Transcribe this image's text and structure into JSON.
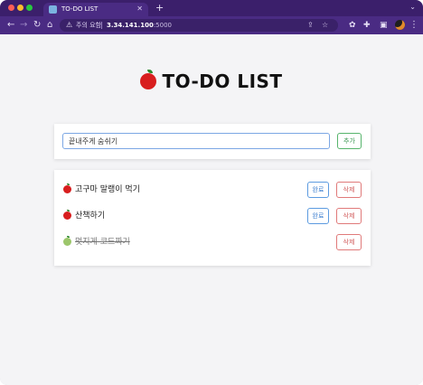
{
  "browser": {
    "tab_title": "TO-DO LIST",
    "new_tab_label": "+",
    "security_label": "주의 요함",
    "url_host": "3.34.141.100",
    "url_port": ":5000"
  },
  "page": {
    "title": "TO-DO LIST",
    "input": {
      "value": "끝내주게 숨쉬기",
      "add_label": "추가"
    },
    "todos": [
      {
        "text": "고구마 말랭이 먹기",
        "done": false,
        "complete_label": "완료",
        "delete_label": "삭제"
      },
      {
        "text": "산책하기",
        "done": false,
        "complete_label": "완료",
        "delete_label": "삭제"
      },
      {
        "text": "멋지게 코드짜기",
        "done": true,
        "delete_label": "삭제"
      }
    ]
  },
  "icons": [
    "back-arrow-icon",
    "forward-arrow-icon",
    "reload-icon",
    "home-icon",
    "warning-icon",
    "share-icon",
    "bookmark-star-icon",
    "extension-icon",
    "puzzle-icon",
    "sidebar-icon",
    "profile-avatar-icon",
    "menu-kebab-icon",
    "apple-icon"
  ]
}
